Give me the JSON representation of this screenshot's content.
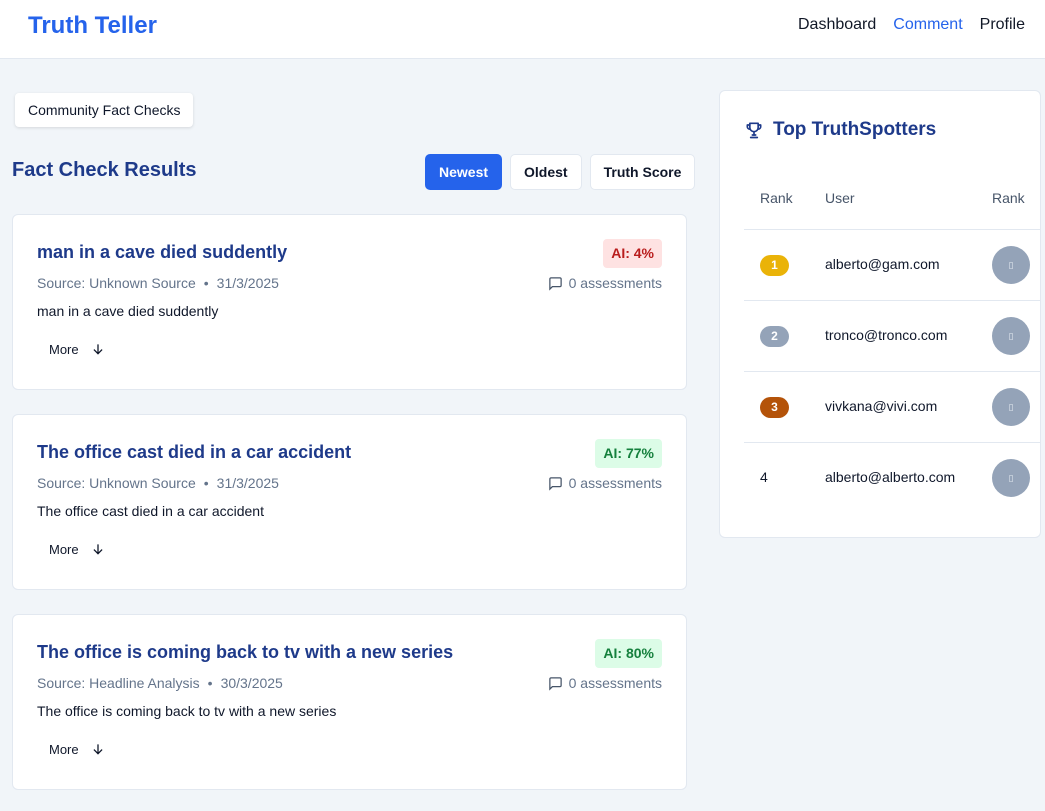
{
  "app": {
    "brand": "Truth Teller"
  },
  "nav": {
    "items": [
      "Dashboard",
      "Comment",
      "Profile"
    ],
    "active": "Comment"
  },
  "community_tab": "Community Fact Checks",
  "results": {
    "title": "Fact Check Results",
    "sort": [
      "Newest",
      "Oldest",
      "Truth Score"
    ],
    "sort_active": "Newest",
    "more_label": "More",
    "cards": [
      {
        "title": "man in a cave died suddently",
        "ai": "AI: 4%",
        "level": "low",
        "source": "Source: Unknown Source",
        "date": "31/3/2025",
        "assessments": "0 assessments",
        "body": "man in a cave died suddently"
      },
      {
        "title": "The office cast died in a car accident",
        "ai": "AI: 77%",
        "level": "high",
        "source": "Source: Unknown Source",
        "date": "31/3/2025",
        "assessments": "0 assessments",
        "body": "The office cast died in a car accident"
      },
      {
        "title": "The office is coming back to tv with a new series",
        "ai": "AI: 80%",
        "level": "high",
        "source": "Source: Headline Analysis",
        "date": "30/3/2025",
        "assessments": "0 assessments",
        "body": "The office is coming back to tv with a new series"
      }
    ]
  },
  "leaderboard": {
    "title": "Top TruthSpotters",
    "columns": [
      "Rank",
      "User",
      "Rank"
    ],
    "rows": [
      {
        "rank": "1",
        "user": "alberto@gam.com",
        "color": "#eab308"
      },
      {
        "rank": "2",
        "user": "tronco@tronco.com",
        "color": "#94a3b8"
      },
      {
        "rank": "3",
        "user": "vivkana@vivi.com",
        "color": "#b45309"
      },
      {
        "rank": "4",
        "user": "alberto@alberto.com",
        "color": ""
      }
    ]
  },
  "colors": {
    "accent": "#2563eb",
    "heading": "#1e3a8a",
    "background": "#f1f5f9"
  },
  "icons": {
    "leaderboard": "trophy-icon",
    "assessments": "comment-icon",
    "more": "arrow-down-icon"
  }
}
